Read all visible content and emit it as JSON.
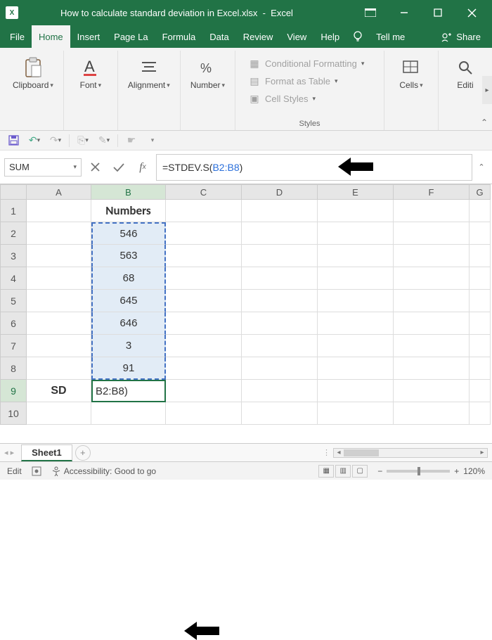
{
  "titlebar": {
    "filename": "How to calculate standard deviation in Excel.xlsx",
    "app": "Excel"
  },
  "menu": {
    "file": "File",
    "home": "Home",
    "insert": "Insert",
    "pagela": "Page La",
    "formula": "Formula",
    "data": "Data",
    "review": "Review",
    "view": "View",
    "help": "Help",
    "tellme": "Tell me",
    "share": "Share"
  },
  "ribbon": {
    "clipboard": "Clipboard",
    "font": "Font",
    "alignment": "Alignment",
    "number": "Number",
    "cond_fmt": "Conditional Formatting",
    "fmt_table": "Format as Table",
    "cell_styles": "Cell Styles",
    "styles_label": "Styles",
    "cells": "Cells",
    "editing": "Editi"
  },
  "formula": {
    "namebox": "SUM",
    "prefix": "=STDEV.S(",
    "range": "B2:B8",
    "suffix": ")"
  },
  "columns": [
    "A",
    "B",
    "C",
    "D",
    "E",
    "F",
    "G"
  ],
  "rows": [
    "1",
    "2",
    "3",
    "4",
    "5",
    "6",
    "7",
    "8",
    "9",
    "10"
  ],
  "cells": {
    "B1": "Numbers",
    "B2": "546",
    "B3": "563",
    "B4": "68",
    "B5": "645",
    "B6": "646",
    "B7": "3",
    "B8": "91",
    "A9": "SD",
    "B9": "B2:B8)"
  },
  "sheet": {
    "name": "Sheet1"
  },
  "status": {
    "mode": "Edit",
    "accessibility": "Accessibility: Good to go",
    "zoom": "120%"
  },
  "chart_data": {
    "type": "table",
    "title": "Numbers",
    "values": [
      546,
      563,
      68,
      645,
      646,
      3,
      91
    ],
    "formula": "=STDEV.S(B2:B8)",
    "result_label": "SD"
  }
}
